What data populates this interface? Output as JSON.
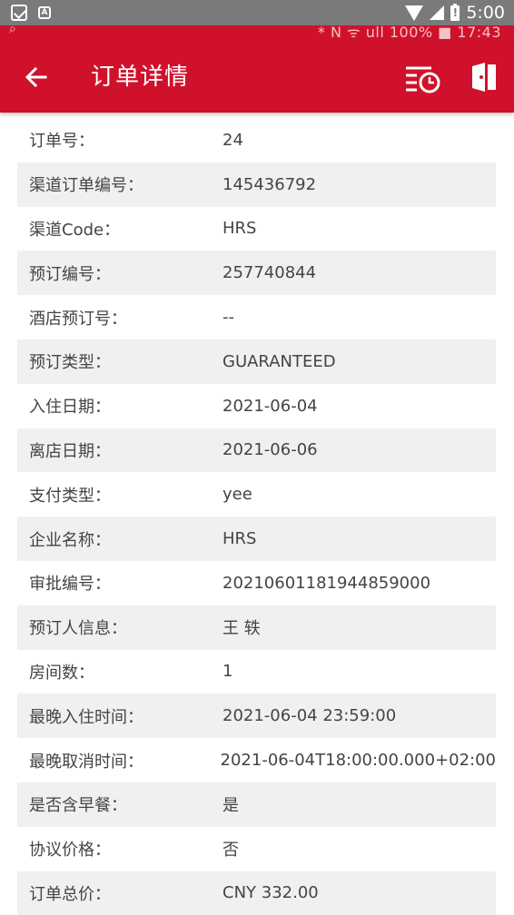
{
  "status_bar": {
    "time": "5:00",
    "icons": [
      "mail-icon",
      "a-icon",
      "wifi-icon",
      "signal-icon",
      "battery-alert-icon"
    ]
  },
  "inner_status": {
    "text": "* N ᯤ ull 100% ■ 17:43"
  },
  "app_bar": {
    "title": "订单详情",
    "icons": [
      "back-arrow-icon",
      "history-list-icon",
      "door-exit-icon"
    ]
  },
  "details": [
    {
      "label": "订单号：",
      "value": "24"
    },
    {
      "label": "渠道订单编号：",
      "value": "145436792"
    },
    {
      "label": "渠道Code：",
      "value": "HRS"
    },
    {
      "label": "预订编号：",
      "value": "257740844"
    },
    {
      "label": "酒店预订号：",
      "value": "--"
    },
    {
      "label": "预订类型：",
      "value": "GUARANTEED"
    },
    {
      "label": "入住日期：",
      "value": "2021-06-04"
    },
    {
      "label": "离店日期：",
      "value": "2021-06-06"
    },
    {
      "label": "支付类型：",
      "value": "yee"
    },
    {
      "label": "企业名称：",
      "value": "HRS"
    },
    {
      "label": "审批编号：",
      "value": "20210601181944859000"
    },
    {
      "label": "预订人信息：",
      "value": "王 轶"
    },
    {
      "label": "房间数：",
      "value": "1"
    },
    {
      "label": "最晚入住时间：",
      "value": "2021-06-04 23:59:00"
    },
    {
      "label": "最晚取消时间：",
      "value": "2021-06-04T18:00:00.000+02:00"
    },
    {
      "label": "是否含早餐：",
      "value": "是"
    },
    {
      "label": "协议价格：",
      "value": "否"
    },
    {
      "label": "订单总价：",
      "value": "CNY 332.00"
    }
  ],
  "colors": {
    "brand_red": "#d0112b",
    "row_alt": "#f0f0f0",
    "text": "#444444"
  }
}
